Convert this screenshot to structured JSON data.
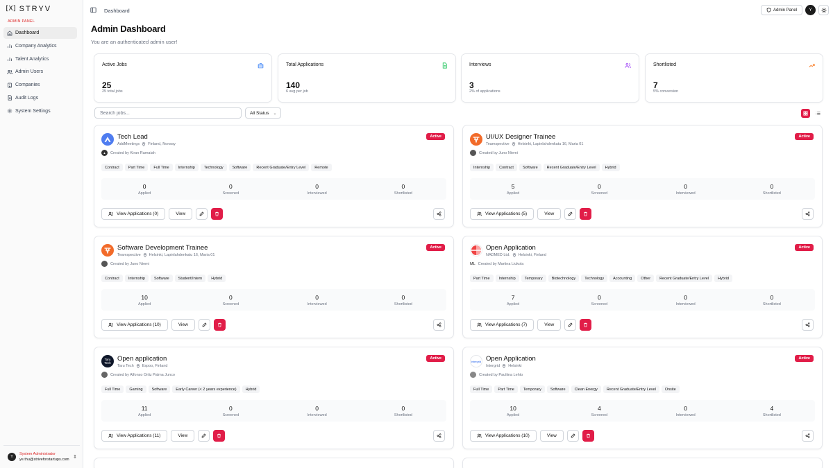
{
  "app": {
    "logo_mark": "[X]",
    "logo_text": "STRYV"
  },
  "sidebar": {
    "section_label": "ADMIN PANEL",
    "items": [
      {
        "label": "Dashboard",
        "icon": "home-icon",
        "active": true
      },
      {
        "label": "Company Analytics",
        "icon": "bar-chart-icon"
      },
      {
        "label": "Talent Analytics",
        "icon": "bar-chart-icon"
      },
      {
        "label": "Admin Users",
        "icon": "users-icon"
      },
      {
        "label": "Companies",
        "icon": "building-icon"
      },
      {
        "label": "Audit Logs",
        "icon": "file-icon"
      },
      {
        "label": "System Settings",
        "icon": "gear-icon"
      }
    ],
    "user": {
      "role": "System Administrator",
      "email": "ye.thu@striveforstartups.com",
      "avatar": "Y"
    }
  },
  "header": {
    "breadcrumb": "Dashboard",
    "admin_panel_label": "Admin Panel",
    "avatar": "Y"
  },
  "page": {
    "title": "Admin Dashboard",
    "subtitle": "You are an authenticated admin user!"
  },
  "stats": [
    {
      "label": "Active Jobs",
      "value": "25",
      "sub": "25 total jobs",
      "icon": "briefcase-icon",
      "color": "#3b82f6"
    },
    {
      "label": "Total Applications",
      "value": "140",
      "sub": "6 avg per job",
      "icon": "document-icon",
      "color": "#22c55e"
    },
    {
      "label": "Interviews",
      "value": "3",
      "sub": "2% of applications",
      "icon": "users-icon",
      "color": "#a855f7"
    },
    {
      "label": "Shortlisted",
      "value": "7",
      "sub": "5% conversion",
      "icon": "trending-up-icon",
      "color": "#f97316"
    }
  ],
  "filters": {
    "search_placeholder": "Search jobs...",
    "status_value": "All Status"
  },
  "jobs": [
    {
      "title": "Tech Lead",
      "company": "AddMeetings",
      "location": "Finland, Norway",
      "creator": "Created by Kiran Ramaiah",
      "status": "Active",
      "tags": [
        "Contract",
        "Part Time",
        "Full Time",
        "Internship",
        "Technology",
        "Software",
        "Recent Graduate/Entry Level",
        "Remote"
      ],
      "metrics": [
        {
          "v": "0",
          "l": "Applied"
        },
        {
          "v": "0",
          "l": "Screened"
        },
        {
          "v": "0",
          "l": "Interviewed"
        },
        {
          "v": "0",
          "l": "Shortlisted"
        }
      ],
      "view_apps": "View Applications (0)",
      "view": "View"
    },
    {
      "title": "UI/UX Designer Trainee",
      "company": "Teamspective",
      "location": "Helsinki, Lapinlahdenkatu 16, Maria 01",
      "creator": "Created by Juno Niemi",
      "status": "Active",
      "tags": [
        "Internship",
        "Contract",
        "Software",
        "Recent Graduate/Entry Level",
        "Hybrid"
      ],
      "metrics": [
        {
          "v": "5",
          "l": "Applied"
        },
        {
          "v": "0",
          "l": "Screened"
        },
        {
          "v": "0",
          "l": "Interviewed"
        },
        {
          "v": "0",
          "l": "Shortlisted"
        }
      ],
      "view_apps": "View Applications (5)",
      "view": "View"
    },
    {
      "title": "Software Development Trainee",
      "company": "Teamspective",
      "location": "Helsinki, Lapinlahdenkatu 16, Maria 01",
      "creator": "Created by Juno Niemi",
      "status": "Active",
      "tags": [
        "Contract",
        "Internship",
        "Software",
        "Student/Intern",
        "Hybrid"
      ],
      "metrics": [
        {
          "v": "10",
          "l": "Applied"
        },
        {
          "v": "0",
          "l": "Screened"
        },
        {
          "v": "0",
          "l": "Interviewed"
        },
        {
          "v": "0",
          "l": "Shortlisted"
        }
      ],
      "view_apps": "View Applications (10)",
      "view": "View"
    },
    {
      "title": "Open Application",
      "company": "NADMED Ltd.",
      "location": "Helsinki, Finland",
      "creator": "Created by Martina Liukola",
      "creator_initials": "ML",
      "status": "Active",
      "tags": [
        "Part Time",
        "Internship",
        "Temporary",
        "Biotechnology",
        "Technology",
        "Accounting",
        "Other",
        "Recent Graduate/Entry Level",
        "Hybrid"
      ],
      "metrics": [
        {
          "v": "7",
          "l": "Applied"
        },
        {
          "v": "0",
          "l": "Screened"
        },
        {
          "v": "0",
          "l": "Interviewed"
        },
        {
          "v": "0",
          "l": "Shortlisted"
        }
      ],
      "view_apps": "View Applications (7)",
      "view": "View"
    },
    {
      "title": "Open application",
      "company": "Taru Tech",
      "location": "Espoo, Finland",
      "creator": "Created by Alfonso Ortiz Palma Junco",
      "status": "Active",
      "logo_text": "Taru Tech",
      "tags": [
        "Full Time",
        "Gaming",
        "Software",
        "Early Career (< 2 years experience)",
        "Hybrid"
      ],
      "metrics": [
        {
          "v": "11",
          "l": "Applied"
        },
        {
          "v": "0",
          "l": "Screened"
        },
        {
          "v": "0",
          "l": "Interviewed"
        },
        {
          "v": "0",
          "l": "Shortlisted"
        }
      ],
      "view_apps": "View Applications (11)",
      "view": "View"
    },
    {
      "title": "Open Application",
      "company": "Intergrid",
      "location": "Helsinki",
      "creator": "Created by Pauliina Lehto",
      "status": "Active",
      "logo_text": "intergrid",
      "tags": [
        "Full Time",
        "Part Time",
        "Temporary",
        "Software",
        "Clean Energy",
        "Recent Graduate/Entry Level",
        "Onsite"
      ],
      "metrics": [
        {
          "v": "10",
          "l": "Applied"
        },
        {
          "v": "4",
          "l": "Screened"
        },
        {
          "v": "0",
          "l": "Interviewed"
        },
        {
          "v": "4",
          "l": "Shortlisted"
        }
      ],
      "view_apps": "View Applications (10)",
      "view": "View"
    }
  ]
}
